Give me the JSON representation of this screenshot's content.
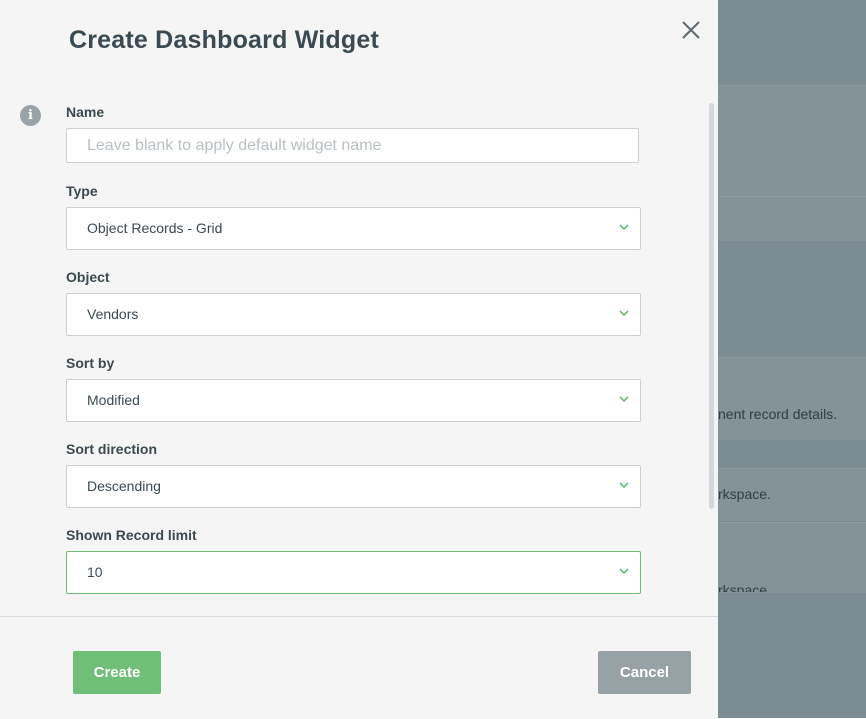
{
  "dialog": {
    "title": "Create Dashboard Widget",
    "close_icon": "close-icon",
    "info_icon": "info-icon",
    "info_glyph": "i"
  },
  "fields": {
    "name": {
      "label": "Name",
      "value": "",
      "placeholder": "Leave blank to apply default widget name"
    },
    "type": {
      "label": "Type",
      "value": "Object Records - Grid"
    },
    "object": {
      "label": "Object",
      "value": "Vendors"
    },
    "sort_by": {
      "label": "Sort by",
      "value": "Modified"
    },
    "sort_direction": {
      "label": "Sort direction",
      "value": "Descending"
    },
    "record_limit": {
      "label": "Shown Record limit",
      "value": "10"
    }
  },
  "footer": {
    "create_label": "Create",
    "cancel_label": "Cancel"
  },
  "background": {
    "snippets": [
      "nent record details.",
      "rkspace.",
      "rkspace."
    ]
  },
  "colors": {
    "accent_green": "#6fbf78",
    "cancel_gray": "#97a2a7",
    "title_text": "#3a4a52",
    "overlay": "#7b8c93"
  }
}
